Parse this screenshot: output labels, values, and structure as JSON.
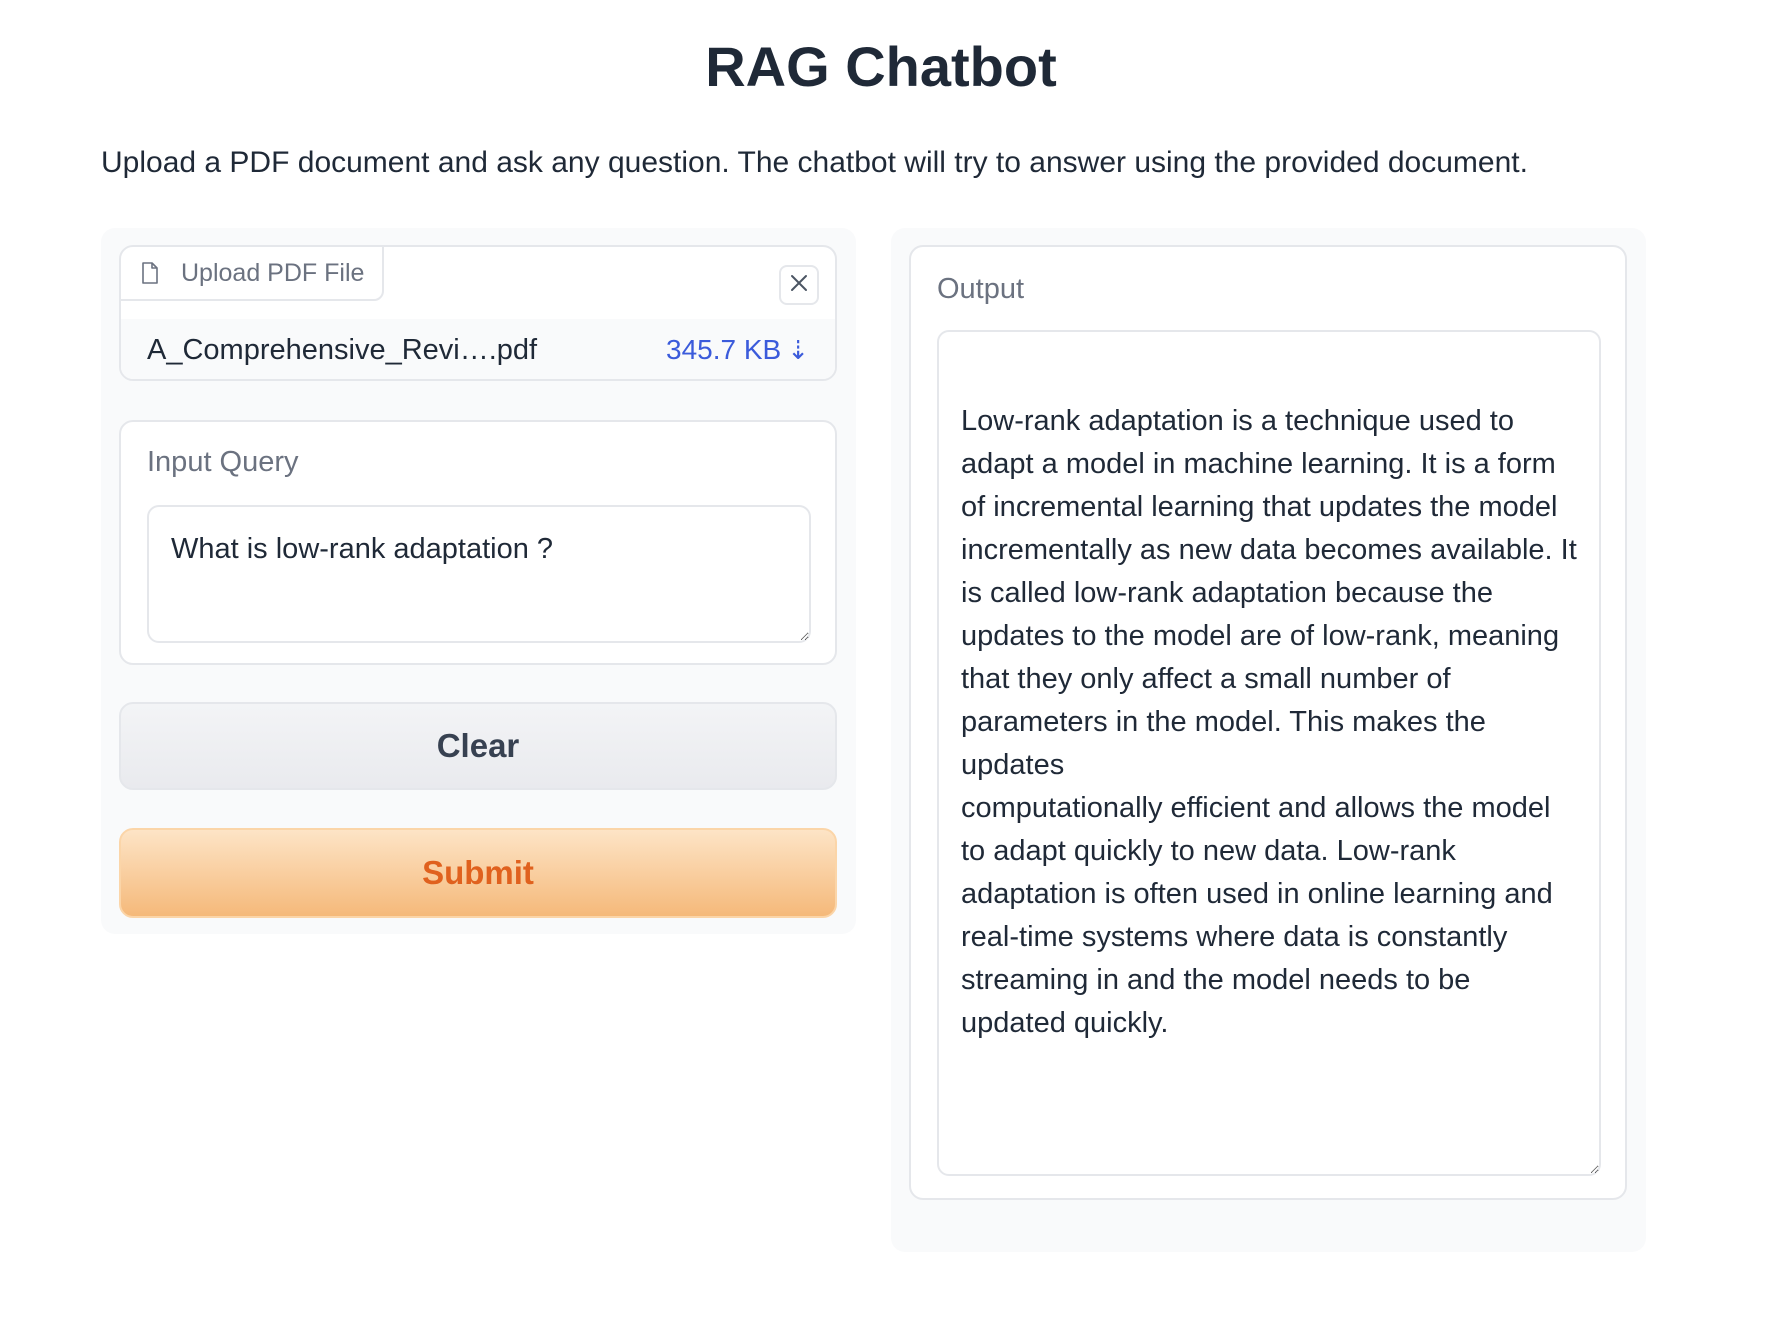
{
  "header": {
    "title": "RAG Chatbot",
    "description": "Upload a PDF document and ask any question. The chatbot will try to answer using the provided document."
  },
  "upload": {
    "label": "Upload PDF File",
    "file_name": "A_Comprehensive_Revi….pdf",
    "file_size": "345.7 KB",
    "download_icon": "⇣",
    "icons": {
      "file": "file-icon",
      "close": "close-icon",
      "download": "download-icon"
    }
  },
  "query": {
    "label": "Input Query",
    "value": "What is low-rank adaptation ?"
  },
  "buttons": {
    "clear": "Clear",
    "submit": "Submit"
  },
  "output": {
    "label": "Output",
    "text": "Low-rank adaptation is a technique used to adapt a model in machine learning. It is a form of incremental learning that updates the model incrementally as new data becomes available. It is called low-rank adaptation because the updates to the model are of low-rank, meaning that they only affect a small number of parameters in the model. This makes the updates\ncomputationally efficient and allows the model to adapt quickly to new data. Low-rank adaptation is often used in online learning and real-time systems where data is constantly streaming in and the model needs to be updated quickly."
  },
  "colors": {
    "submit_text": "#e0611e",
    "file_size_link": "#3b5bdb",
    "panel_background": "#f9fafb",
    "border": "#e5e7eb"
  }
}
